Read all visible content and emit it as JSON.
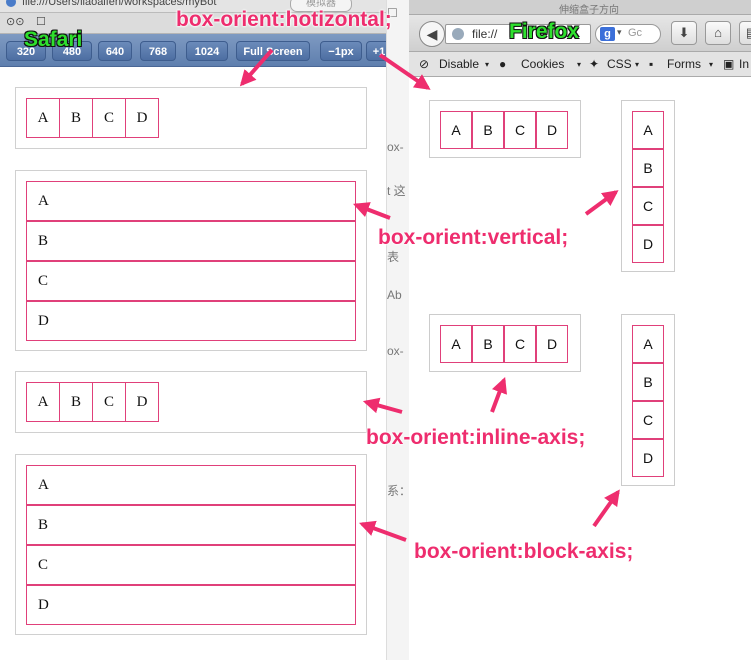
{
  "safari": {
    "brand": "Safari",
    "url": "file:///Users/liaoaifen/workspaces/myBot",
    "url_right": "模拟器",
    "bookmarks": [
      "⊙⊙",
      "☐"
    ],
    "toolbar": {
      "buttons": [
        "320",
        "480",
        "640",
        "768",
        "1024",
        "Full Screen",
        "−1px",
        "+1"
      ]
    },
    "demo_boxes": [
      {
        "orientation": "horizontal",
        "items": [
          "A",
          "B",
          "C",
          "D"
        ]
      },
      {
        "orientation": "vertical",
        "items": [
          "A",
          "B",
          "C",
          "D"
        ]
      },
      {
        "orientation": "inline-axis",
        "items": [
          "A",
          "B",
          "C",
          "D"
        ]
      },
      {
        "orientation": "block-axis",
        "items": [
          "A",
          "B",
          "C",
          "D"
        ]
      }
    ]
  },
  "gutter_text": [
    "☐",
    "ox-",
    "t 这",
    "表",
    "Ab",
    "ox-",
    "系："
  ],
  "firefox": {
    "brand": "Firefox",
    "tab_title": "伸缩盒子方向",
    "url": "file://",
    "search_placeholder": "Gc",
    "search_engine": "g",
    "nav_buttons": [
      "⬇",
      "⌂",
      "▤"
    ],
    "devbar": {
      "disable": "Disable",
      "cookies": "Cookies",
      "css": "CSS",
      "forms": "Forms",
      "images": "In"
    },
    "demo_boxes": [
      {
        "orientation": "horizontal",
        "items": [
          "A",
          "B",
          "C",
          "D"
        ]
      },
      {
        "orientation": "vertical",
        "items": [
          "A",
          "B",
          "C",
          "D"
        ]
      },
      {
        "orientation": "inline-axis",
        "items": [
          "A",
          "B",
          "C",
          "D"
        ]
      },
      {
        "orientation": "block-axis",
        "items": [
          "A",
          "B",
          "C",
          "D"
        ]
      }
    ]
  },
  "annotations": {
    "horizontal": "box-orient:hotizontal;",
    "vertical": "box-orient:vertical;",
    "inline_axis": "box-orient:inline-axis;",
    "block_axis": "box-orient:block-axis;"
  },
  "colors": {
    "annotation": "#ee2d6e",
    "brand_label": "#2ee02e",
    "cell_border": "#e0407a",
    "safari_toolbar": "#6b8bba"
  }
}
